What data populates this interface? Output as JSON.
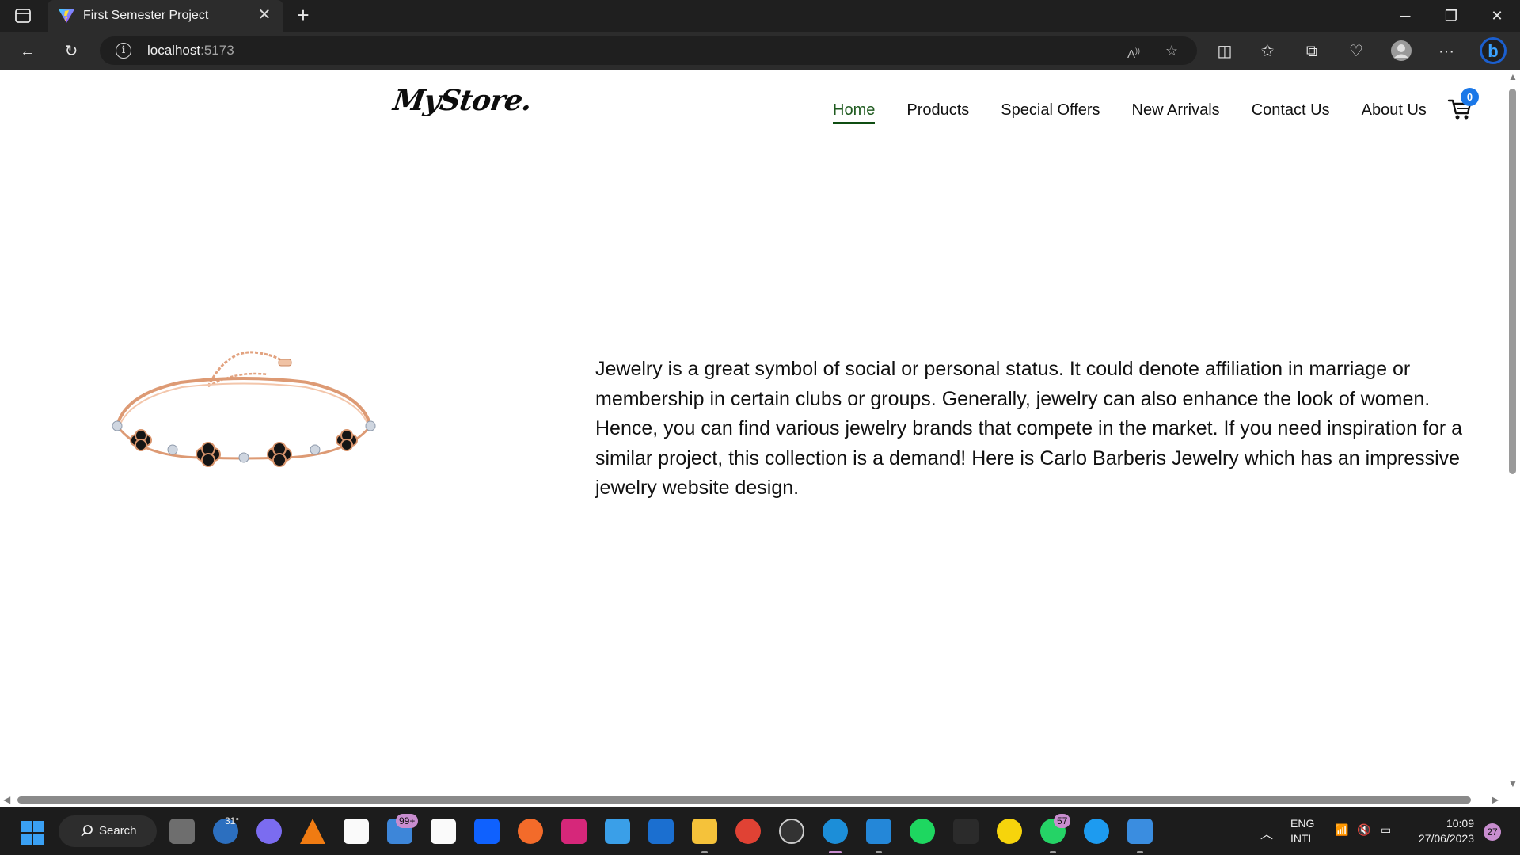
{
  "browser": {
    "tab_title": "First Semester Project",
    "new_tab_icon": "+",
    "address_host": "localhost",
    "address_port": ":5173"
  },
  "site": {
    "logo_text": "MyStore.",
    "nav": {
      "items": [
        {
          "label": "Home",
          "active": true
        },
        {
          "label": "Products",
          "active": false
        },
        {
          "label": "Special Offers",
          "active": false
        },
        {
          "label": "New Arrivals",
          "active": false
        },
        {
          "label": "Contact Us",
          "active": false
        },
        {
          "label": "About Us",
          "active": false
        }
      ],
      "cart_count": "0",
      "active_color": "#0f4d12"
    },
    "hero": {
      "image_icon": "bracelet-image",
      "text": "Jewelry is a great symbol of social or personal status. It could denote affiliation in marriage or membership in certain clubs or groups. Generally, jewelry can also enhance the look of women. Hence, you can find various jewelry brands that compete in the market. If you need inspiration for a similar project, this collection is a demand! Here is Carlo Barberis Jewelry which has an impressive jewelry website design."
    }
  },
  "taskbar": {
    "search_label": "Search",
    "weather_temp": "31°",
    "mail_badge": "99+",
    "whatsapp_badge": "57",
    "lang_top": "ENG",
    "lang_bottom": "INTL",
    "time": "10:09",
    "date": "27/06/2023",
    "notification_count": "27"
  }
}
